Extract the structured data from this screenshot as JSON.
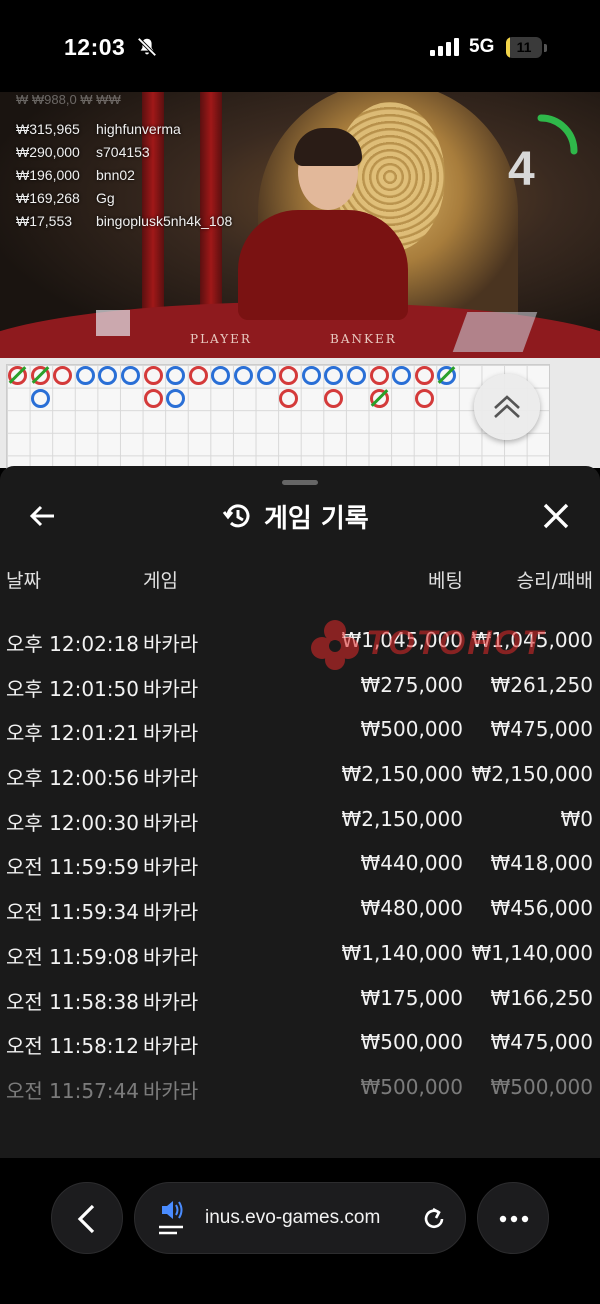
{
  "status_bar": {
    "time": "12:03",
    "network": "5G",
    "battery": "11",
    "battery_level": 0.11,
    "battery_color": "#f2d44a"
  },
  "video": {
    "leaderboard_top_partial": "₩ ₩988,0 ₩ ₩₩",
    "leaderboard": [
      {
        "amount": "₩315,965",
        "name": "highfunverma"
      },
      {
        "amount": "₩290,000",
        "name": "s704153"
      },
      {
        "amount": "₩196,000",
        "name": "bnn02"
      },
      {
        "amount": "₩169,268",
        "name": "Gg"
      },
      {
        "amount": "₩17,553",
        "name": "bingoplusk5nh4k_108"
      }
    ],
    "timer": "4",
    "timer_color": "#2fb84a",
    "table_labels": {
      "player": "PLAYER",
      "banker": "BANKER"
    }
  },
  "roadmap": {
    "player_color": "#2a6fd6",
    "banker_color": "#d43a3a",
    "side_results": [
      "P",
      "P",
      "B"
    ]
  },
  "panel": {
    "title": "게임 기록",
    "columns": {
      "date": "날짜",
      "game": "게임",
      "bet": "베팅",
      "result": "승리/패배"
    },
    "rows": [
      {
        "time": "오후 12:02:18",
        "game": "바카라",
        "bet": "₩1,045,000",
        "result": "₩1,045,000"
      },
      {
        "time": "오후 12:01:50",
        "game": "바카라",
        "bet": "₩275,000",
        "result": "₩261,250"
      },
      {
        "time": "오후 12:01:21",
        "game": "바카라",
        "bet": "₩500,000",
        "result": "₩475,000"
      },
      {
        "time": "오후 12:00:56",
        "game": "바카라",
        "bet": "₩2,150,000",
        "result": "₩2,150,000"
      },
      {
        "time": "오후 12:00:30",
        "game": "바카라",
        "bet": "₩2,150,000",
        "result": "₩0"
      },
      {
        "time": "오전 11:59:59",
        "game": "바카라",
        "bet": "₩440,000",
        "result": "₩418,000"
      },
      {
        "time": "오전 11:59:34",
        "game": "바카라",
        "bet": "₩480,000",
        "result": "₩456,000"
      },
      {
        "time": "오전 11:59:08",
        "game": "바카라",
        "bet": "₩1,140,000",
        "result": "₩1,140,000"
      },
      {
        "time": "오전 11:58:38",
        "game": "바카라",
        "bet": "₩175,000",
        "result": "₩166,250"
      },
      {
        "time": "오전 11:58:12",
        "game": "바카라",
        "bet": "₩500,000",
        "result": "₩475,000"
      },
      {
        "time": "오전 11:57:44",
        "game": "바카라",
        "bet": "₩500,000",
        "result": "₩500,000"
      }
    ],
    "watermark": "TOTOHOT",
    "watermark_color": "#e02a2a"
  },
  "browser": {
    "url": "inus.evo-games.com"
  }
}
